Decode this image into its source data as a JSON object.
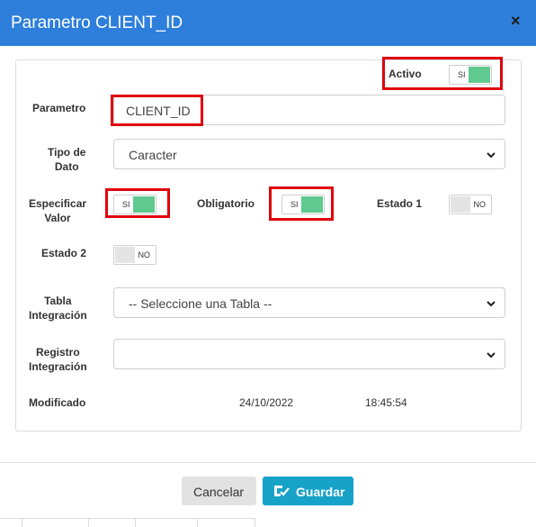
{
  "dialog": {
    "title": "Parametro CLIENT_ID",
    "close_glyph": "×"
  },
  "form": {
    "activo": {
      "label": "Activo",
      "toggle_text": "SI",
      "state": "on"
    },
    "parametro": {
      "label": "Parametro",
      "value": "CLIENT_ID"
    },
    "tipo_dato": {
      "label_line1": "Tipo de",
      "label_line2": "Dato",
      "value": "Caracter"
    },
    "especificar_valor": {
      "label_line1": "Especificar",
      "label_line2": "Valor",
      "toggle_text": "SI",
      "state": "on"
    },
    "obligatorio": {
      "label": "Obligatorio",
      "toggle_text": "SI",
      "state": "on"
    },
    "estado1": {
      "label": "Estado 1",
      "toggle_text": "NO",
      "state": "off"
    },
    "estado2": {
      "label": "Estado 2",
      "toggle_text": "NO",
      "state": "off"
    },
    "tabla_integracion": {
      "label_line1": "Tabla",
      "label_line2": "Integración",
      "value": "-- Seleccione una Tabla --"
    },
    "registro_integracion": {
      "label_line1": "Registro",
      "label_line2": "Integración",
      "value": ""
    },
    "modificado": {
      "label": "Modificado",
      "date": "24/10/2022",
      "time": "18:45:54"
    }
  },
  "footer": {
    "cancel_label": "Cancelar",
    "save_label": "Guardar"
  },
  "colors": {
    "header": "#2e7fdb",
    "toggle_on": "#5fc98f",
    "highlight": "#e0000c",
    "save_button": "#17a2c8"
  }
}
